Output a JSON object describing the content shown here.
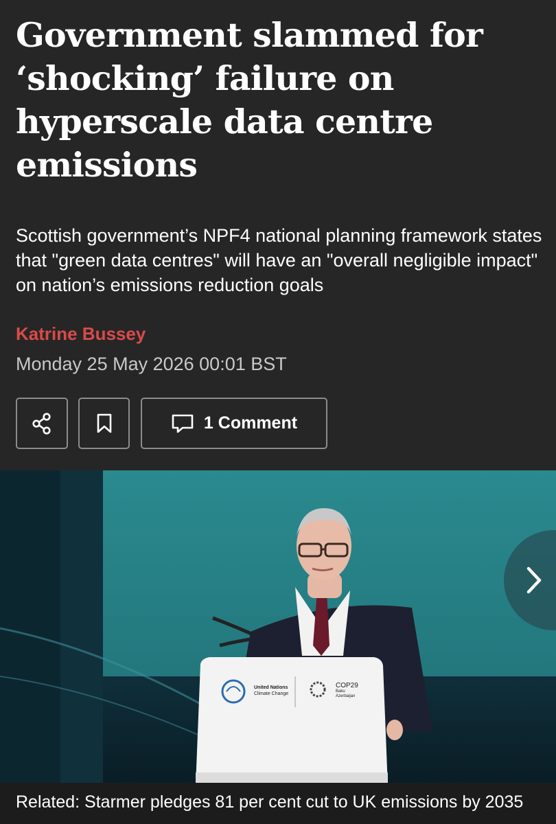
{
  "article": {
    "headline": "Government slammed for ‘shocking’ failure on hyperscale data centre emissions",
    "standfirst": "Scottish government’s NPF4 national planning framework states that \"green data centres\" will have an \"overall negligible impact\" on nation’s emissions reduction goals",
    "author": "Katrine Bussey",
    "date": "Monday 25 May 2026 00:01 BST"
  },
  "actions": {
    "share_icon": "share-icon",
    "bookmark_icon": "bookmark-icon",
    "comment_icon": "comment-icon",
    "comment_label": "1 Comment"
  },
  "media": {
    "podium_un_line1": "United Nations",
    "podium_un_line2": "Climate Change",
    "podium_cop_title": "COP29",
    "podium_cop_line1": "Baku",
    "podium_cop_line2": "Azerbaijan",
    "next_icon": "chevron-right-icon",
    "caption": "Related: Starmer pledges 81 per cent cut to UK emissions by 2035"
  },
  "colors": {
    "background": "#262626",
    "byline": "#d94b49",
    "backdrop": "#1f6f74"
  }
}
